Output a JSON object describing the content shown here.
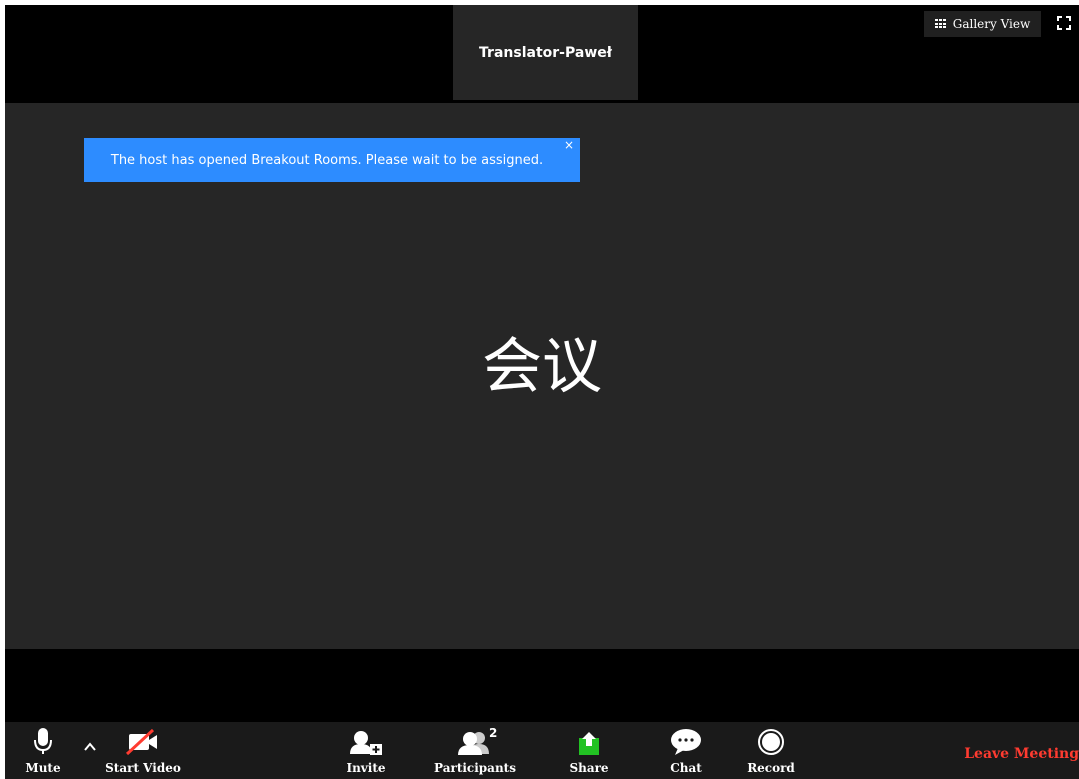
{
  "top": {
    "thumbnail_name": "Translator-Paweł",
    "gallery_view_label": "Gallery View"
  },
  "banner": {
    "message": "The host has opened Breakout Rooms. Please wait to be assigned.",
    "close_glyph": "×"
  },
  "main": {
    "title": "会议"
  },
  "toolbar": {
    "mute_label": "Mute",
    "start_video_label": "Start Video",
    "invite_label": "Invite",
    "participants_label": "Participants",
    "participants_count": "2",
    "share_label": "Share",
    "chat_label": "Chat",
    "record_label": "Record",
    "leave_label": "Leave Meeting"
  },
  "colors": {
    "accent": "#2d8cff",
    "share_green": "#22c223",
    "leave_red": "#ff3b30",
    "video_bg": "#262626",
    "toolbar_bg": "#1a1a1a"
  },
  "icons": [
    "grid-icon",
    "fullscreen-icon",
    "microphone-icon",
    "chevron-up-icon",
    "video-off-icon",
    "invite-icon",
    "participants-icon",
    "share-icon",
    "chat-icon",
    "record-icon"
  ]
}
